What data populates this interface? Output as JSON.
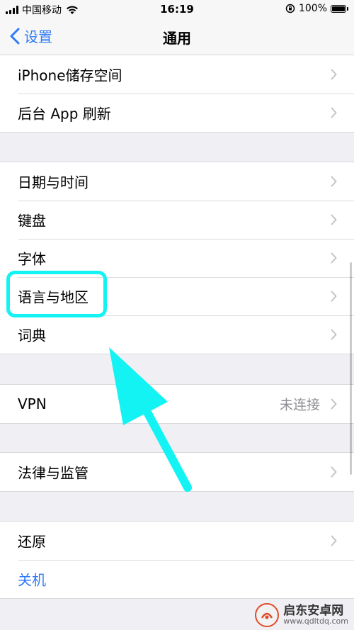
{
  "status_bar": {
    "carrier": "中国移动",
    "time": "16:19",
    "battery": "100%",
    "signal_bars": 4
  },
  "nav": {
    "back_label": "设置",
    "title": "通用"
  },
  "groups": [
    {
      "rows": [
        {
          "label": "iPhone储存空间"
        },
        {
          "label": "后台 App 刷新"
        }
      ]
    },
    {
      "rows": [
        {
          "label": "日期与时间"
        },
        {
          "label": "键盘"
        },
        {
          "label": "字体"
        },
        {
          "label": "语言与地区"
        },
        {
          "label": "词典"
        }
      ]
    },
    {
      "rows": [
        {
          "label": "VPN",
          "value": "未连接"
        }
      ]
    },
    {
      "rows": [
        {
          "label": "法律与监管"
        }
      ]
    },
    {
      "rows": [
        {
          "label": "还原"
        },
        {
          "label": "关机"
        }
      ]
    }
  ],
  "watermark": {
    "title": "启东安卓网",
    "url": "www.qdltdq.com"
  },
  "colors": {
    "accent": "#2f7bf5",
    "highlight": "#14f3f3",
    "background": "#efeff4"
  }
}
